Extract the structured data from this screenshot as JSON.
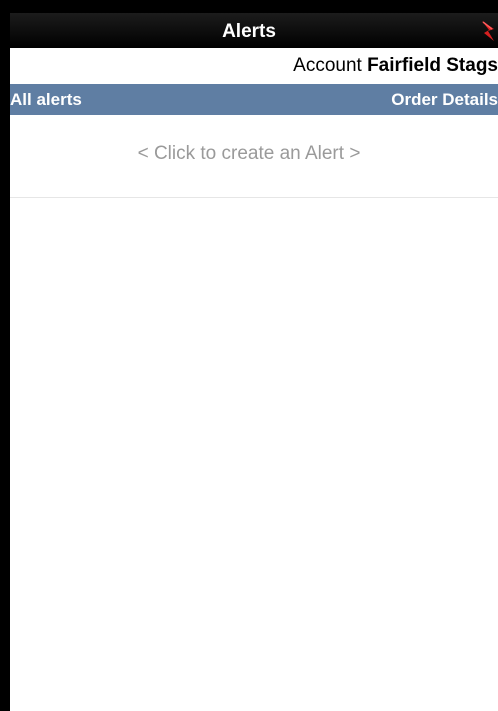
{
  "header": {
    "title": "Alerts",
    "close_icon": "close-icon",
    "close_icon_color": "#d62020"
  },
  "account": {
    "label": "Account",
    "value": "Fairfield Stags"
  },
  "tabs": {
    "left_label": "All alerts",
    "right_label": "Order Details",
    "bar_color": "#5f7ea3"
  },
  "alerts_list": {
    "create_prompt": "< Click to create an Alert >"
  }
}
